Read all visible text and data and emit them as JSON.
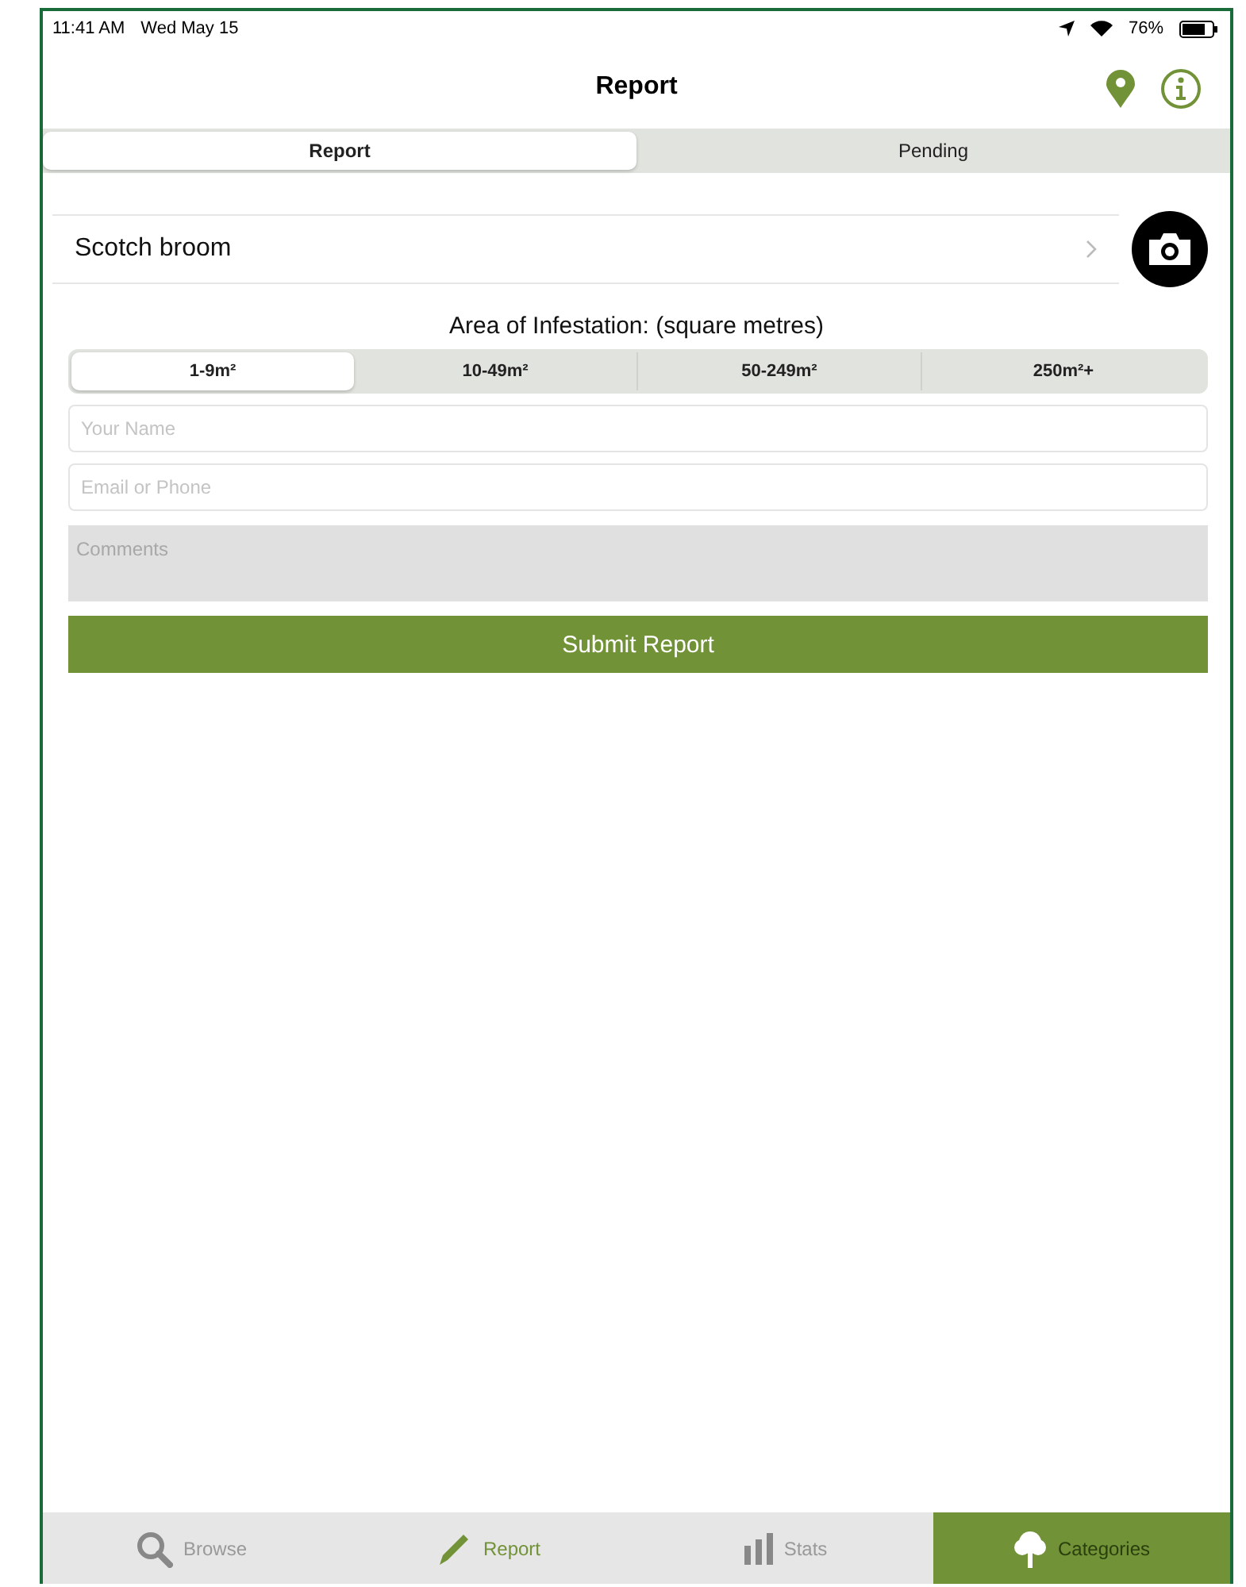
{
  "status_bar": {
    "time": "11:41 AM",
    "date": "Wed May 15",
    "battery": "76%"
  },
  "nav": {
    "title": "Report"
  },
  "tabs": [
    {
      "label": "Report",
      "selected": true
    },
    {
      "label": "Pending",
      "selected": false
    }
  ],
  "species": {
    "name": "Scotch broom"
  },
  "area": {
    "label": "Area of Infestation: (square metres)",
    "options": [
      {
        "label": "1-9m²",
        "selected": true
      },
      {
        "label": "10-49m²",
        "selected": false
      },
      {
        "label": "50-249m²",
        "selected": false
      },
      {
        "label": "250m²+",
        "selected": false
      }
    ]
  },
  "fields": [
    {
      "placeholder": "Your Name"
    },
    {
      "placeholder": "Email or Phone"
    }
  ],
  "comments": {
    "placeholder": "Comments"
  },
  "submit": "Submit Report",
  "tab_bar": [
    {
      "label": "Browse",
      "kind": "search",
      "selected": false,
      "highlighted": false
    },
    {
      "label": "Report",
      "kind": "pencil",
      "selected": true,
      "highlighted": false
    },
    {
      "label": "Stats",
      "kind": "bars",
      "selected": false,
      "highlighted": false
    },
    {
      "label": "Categories",
      "kind": "tree",
      "selected": false,
      "highlighted": true
    }
  ]
}
